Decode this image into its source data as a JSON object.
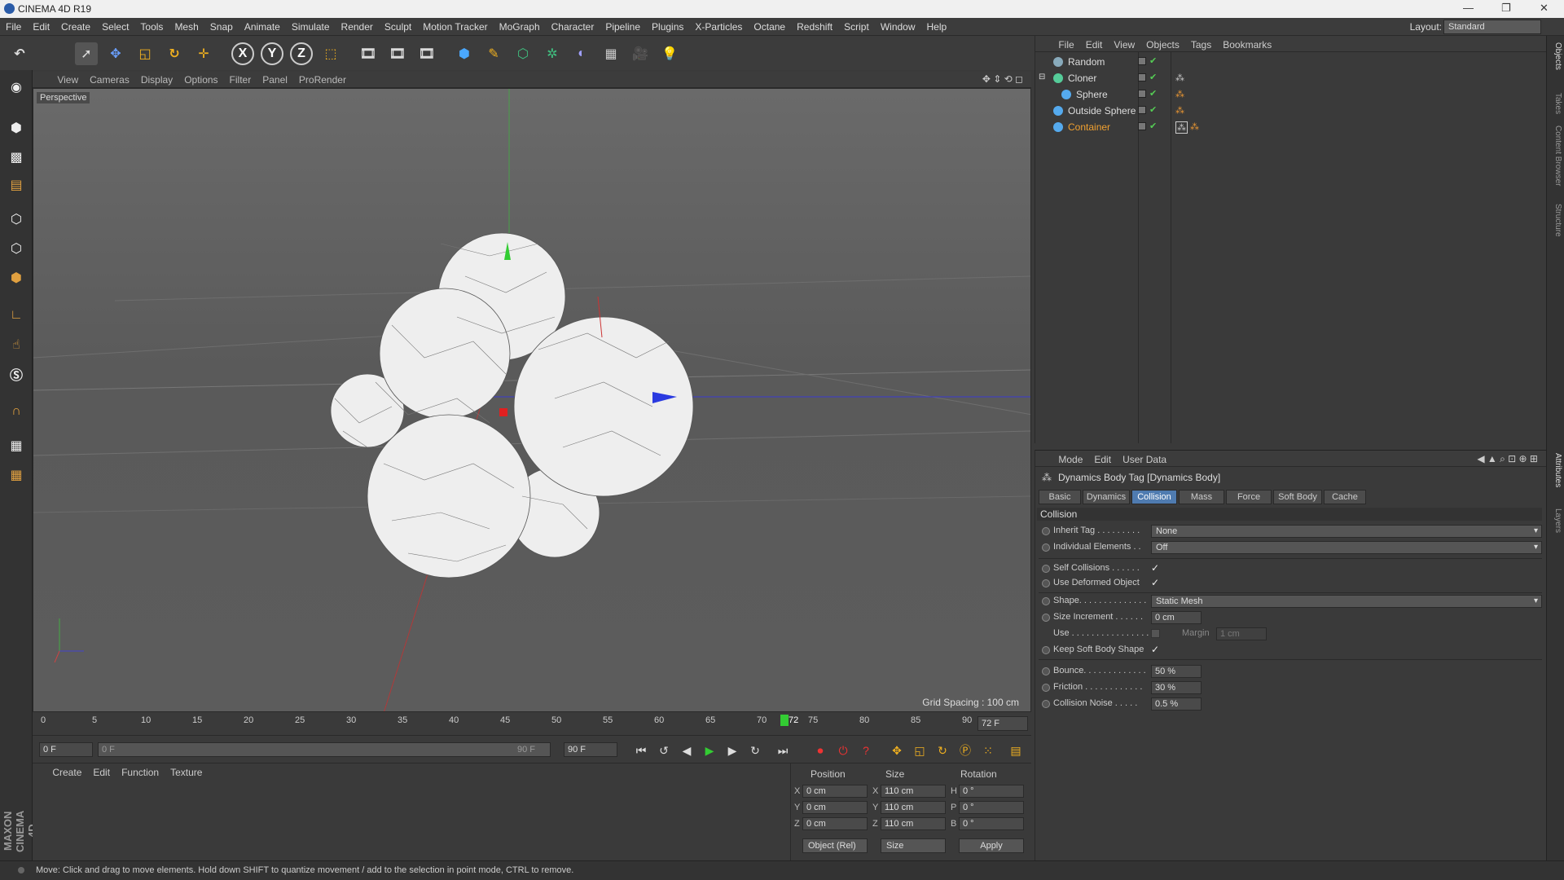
{
  "app": {
    "title": "CINEMA 4D R19"
  },
  "menubar": {
    "items": [
      "File",
      "Edit",
      "Create",
      "Select",
      "Tools",
      "Mesh",
      "Snap",
      "Animate",
      "Simulate",
      "Render",
      "Sculpt",
      "Motion Tracker",
      "MoGraph",
      "Character",
      "Pipeline",
      "Plugins",
      "X-Particles",
      "Octane",
      "Redshift",
      "Script",
      "Window",
      "Help"
    ]
  },
  "layout": {
    "label": "Layout:",
    "value": "Standard"
  },
  "toolbar": {
    "icons": [
      "undo-icon",
      "select-icon",
      "move-icon",
      "scale-icon",
      "rotate-icon",
      "transform-icon",
      "x-axis-icon",
      "y-axis-icon",
      "z-axis-icon",
      "coordinate-system-icon",
      "render-view-icon",
      "render-pv-icon",
      "render-settings-icon",
      "cube-icon",
      "pen-icon",
      "subdivision-icon",
      "cloner-icon",
      "deformer-icon",
      "floor-icon",
      "camera-icon",
      "light-icon"
    ],
    "axis_labels": [
      "X",
      "Y",
      "Z"
    ]
  },
  "viewport": {
    "menu": [
      "View",
      "Cameras",
      "Display",
      "Options",
      "Filter",
      "Panel",
      "ProRender"
    ],
    "label": "Perspective",
    "grid_spacing": "Grid Spacing : 100 cm"
  },
  "timeline": {
    "ticks": [
      "0",
      "5",
      "10",
      "15",
      "20",
      "25",
      "30",
      "35",
      "40",
      "45",
      "50",
      "55",
      "60",
      "65",
      "70",
      "72",
      "75",
      "80",
      "85",
      "90"
    ],
    "current_frame": "72 F",
    "current_frame_value": 72,
    "start": "0 F",
    "range_start": "0 F",
    "range_end": "90 F",
    "end": "90 F"
  },
  "material_manager": {
    "menu": [
      "Create",
      "Edit",
      "Function",
      "Texture"
    ]
  },
  "coordinates": {
    "headers": [
      "Position",
      "Size",
      "Rotation"
    ],
    "rows": [
      {
        "axis": "X",
        "pos": "0 cm",
        "size_axis": "X",
        "size": "110 cm",
        "rot_axis": "H",
        "rot": "0 °"
      },
      {
        "axis": "Y",
        "pos": "0 cm",
        "size_axis": "Y",
        "size": "110 cm",
        "rot_axis": "P",
        "rot": "0 °"
      },
      {
        "axis": "Z",
        "pos": "0 cm",
        "size_axis": "Z",
        "size": "110 cm",
        "rot_axis": "B",
        "rot": "0 °"
      }
    ],
    "mode": "Object (Rel)",
    "size_mode": "Size",
    "apply": "Apply"
  },
  "object_manager": {
    "menu": [
      "File",
      "Edit",
      "View",
      "Objects",
      "Tags",
      "Bookmarks"
    ],
    "objects": [
      {
        "name": "Random",
        "indent": 0,
        "color": "#cccccc"
      },
      {
        "name": "Cloner",
        "indent": 0,
        "color": "#cccccc"
      },
      {
        "name": "Sphere",
        "indent": 1,
        "color": "#cccccc"
      },
      {
        "name": "Outside Sphere",
        "indent": 0,
        "color": "#cccccc"
      },
      {
        "name": "Container",
        "indent": 0,
        "color": "#f0a030"
      }
    ]
  },
  "attribute_manager": {
    "menu": [
      "Mode",
      "Edit",
      "User Data"
    ],
    "title": "Dynamics Body Tag [Dynamics Body]",
    "tabs": [
      "Basic",
      "Dynamics",
      "Collision",
      "Mass",
      "Force",
      "Soft Body",
      "Cache"
    ],
    "active_tab": "Collision",
    "section": "Collision",
    "fields": {
      "inherit_tag": {
        "label": "Inherit Tag . . . . . . . . .",
        "value": "None"
      },
      "individual_elements": {
        "label": "Individual Elements . .",
        "value": "Off"
      },
      "self_collisions": {
        "label": "Self Collisions . . . . . .",
        "value": "✓"
      },
      "use_deformed": {
        "label": "Use Deformed Object",
        "value": "✓"
      },
      "shape": {
        "label": "Shape. . . . . . . . . . . . . .",
        "value": "Static Mesh"
      },
      "size_increment": {
        "label": "Size Increment . . . . . .",
        "value": "0 cm"
      },
      "use": {
        "label": "Use . . . . . . . . . . . . . . . .",
        "margin_label": "Margin",
        "margin_value": "1 cm"
      },
      "keep_soft_body_shape": {
        "label": "Keep Soft Body Shape",
        "value": "✓"
      },
      "bounce": {
        "label": "Bounce. . . . . . . . . . . . .",
        "value": "50 %"
      },
      "friction": {
        "label": "Friction . . . . . . . . . . . .",
        "value": "30 %"
      },
      "collision_noise": {
        "label": "Collision Noise . . . . .",
        "value": "0.5 %"
      }
    }
  },
  "right_strip": {
    "tabs": [
      "Objects",
      "Takes",
      "Content Browser",
      "Structure",
      "Attributes",
      "Layers"
    ]
  },
  "status": {
    "text": "Move: Click and drag to move elements. Hold down SHIFT to quantize movement / add to the selection in point mode, CTRL to remove."
  },
  "brand": {
    "logo_text": "MAXON CINEMA 4D"
  },
  "colors": {
    "accent": "#4f7bb0",
    "container": "#f0a030",
    "x_axis": "#e03030",
    "y_axis": "#30c030",
    "z_axis": "#3040e0"
  }
}
